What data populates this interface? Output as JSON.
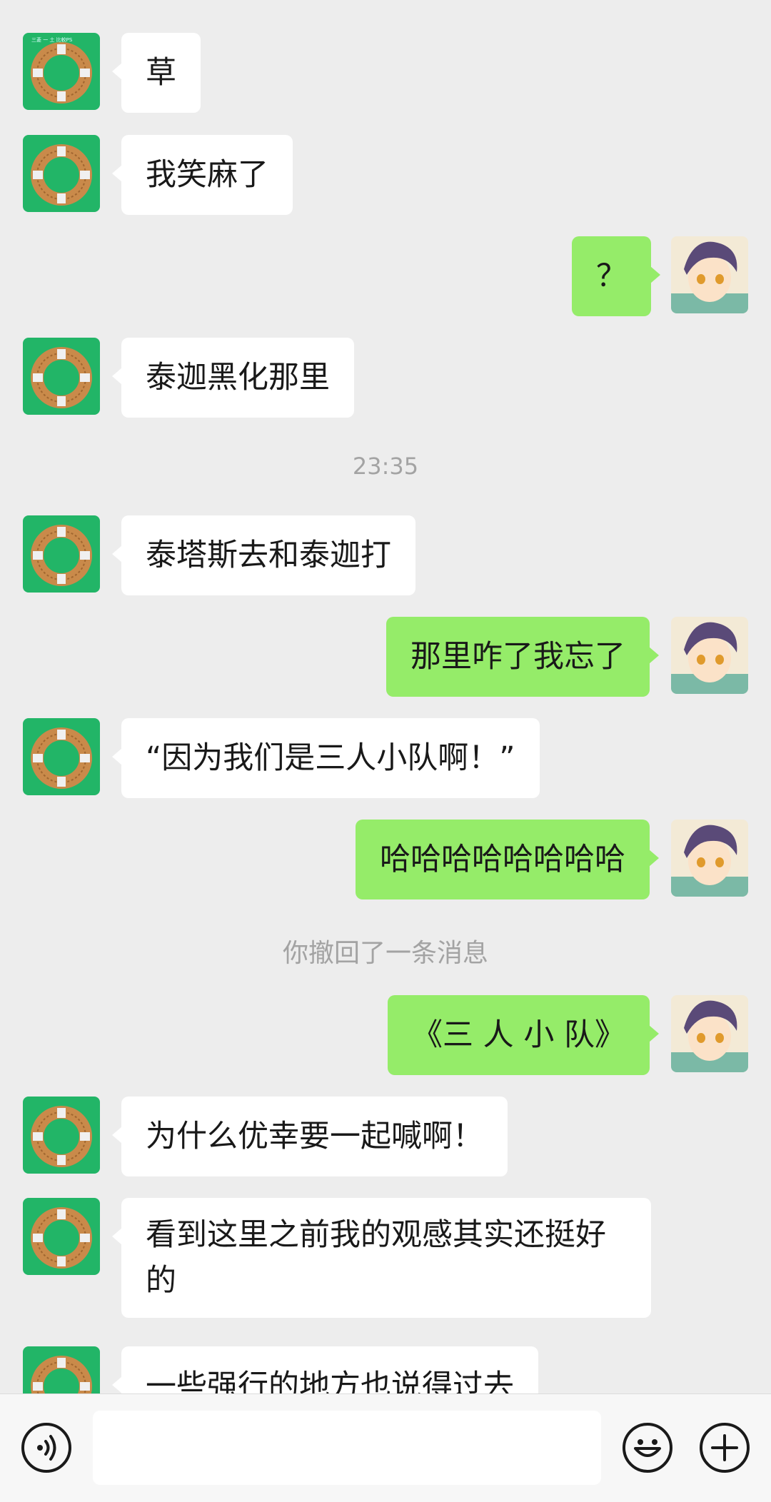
{
  "messages": [
    {
      "side": "in",
      "text": "草"
    },
    {
      "side": "in",
      "text": "我笑麻了"
    },
    {
      "side": "out",
      "text": "？"
    },
    {
      "side": "in",
      "text": "泰迦黑化那里"
    },
    {
      "side": "in",
      "text": "泰塔斯去和泰迦打"
    },
    {
      "side": "out",
      "text": "那里咋了我忘了"
    },
    {
      "side": "in",
      "text": "“因为我们是三人小队啊！”"
    },
    {
      "side": "out",
      "text": "哈哈哈哈哈哈哈哈"
    },
    {
      "side": "out",
      "text": "《三 人 小 队》"
    },
    {
      "side": "in",
      "text": "为什么优幸要一起喊啊！"
    },
    {
      "side": "in",
      "text": "看到这里之前我的观感其实还挺好的"
    },
    {
      "side": "in",
      "text": "一些强行的地方也说得过去"
    }
  ],
  "timestamp": "23:35",
  "recall_notice": "你撤回了一条消息",
  "input": {
    "value": "",
    "placeholder": ""
  },
  "icons": {
    "voice": "voice-mode-icon",
    "emoji": "emoji-icon",
    "plus": "more-functions-icon"
  },
  "colors": {
    "background": "#ededed",
    "incoming_bubble": "#ffffff",
    "outgoing_bubble": "#95ec69",
    "system_text": "#a3a3a3"
  }
}
